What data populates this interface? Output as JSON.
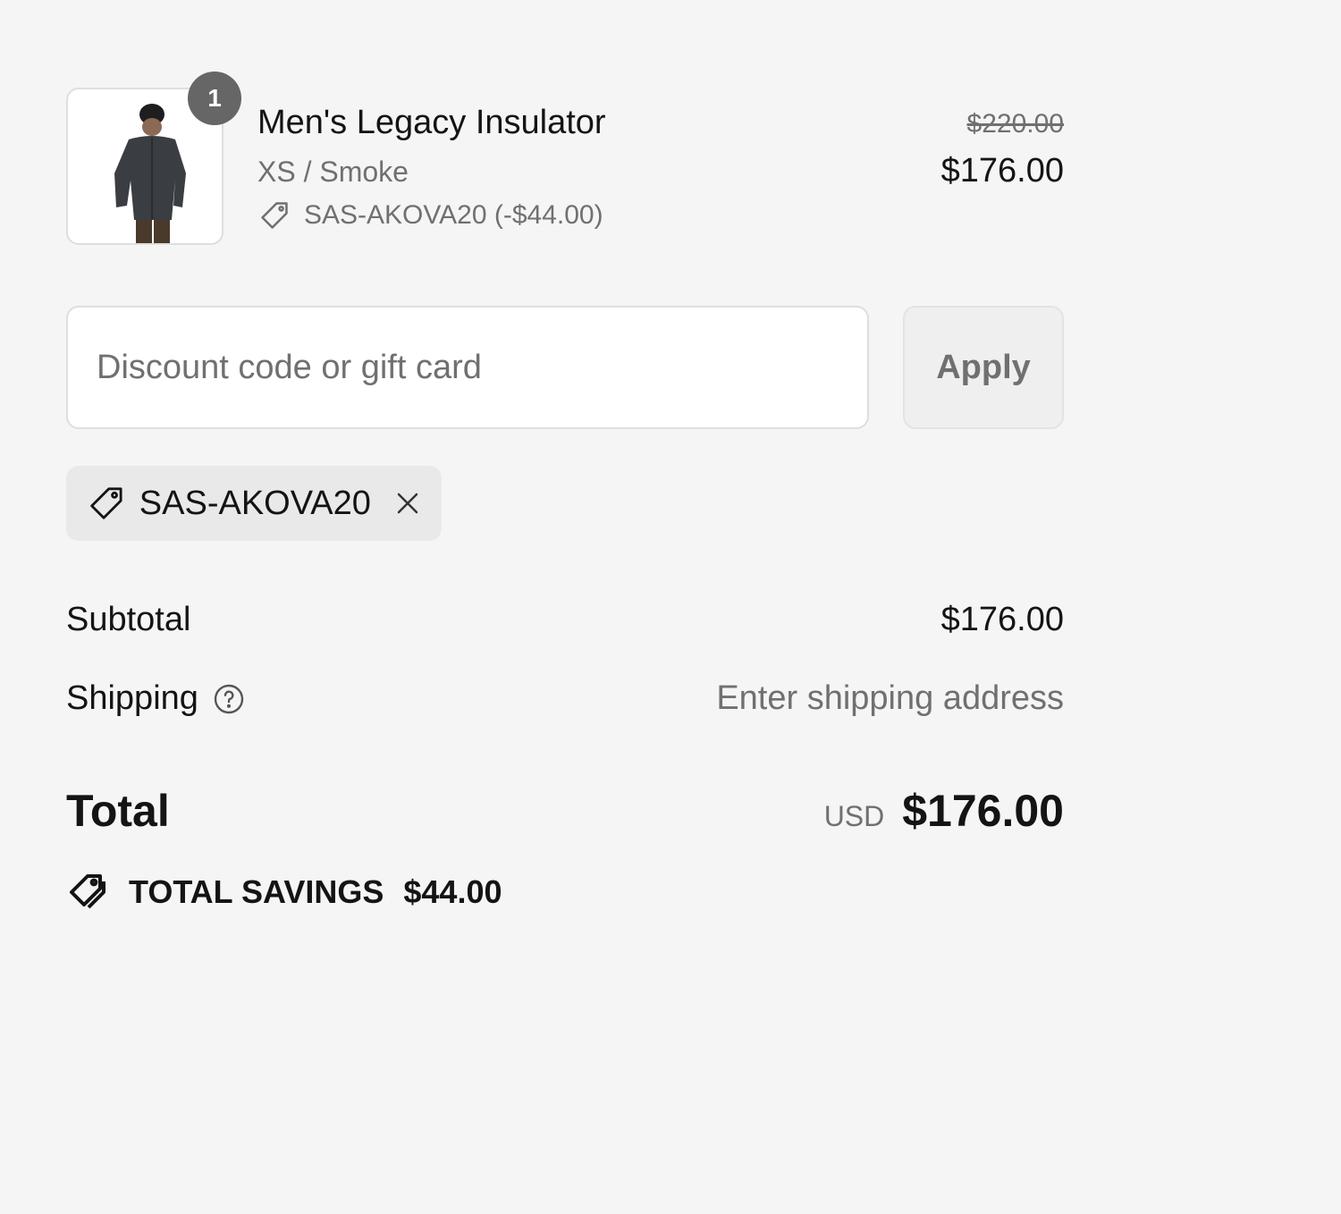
{
  "line_item": {
    "quantity": "1",
    "title": "Men's Legacy Insulator",
    "variant": "XS / Smoke",
    "discount_line": "SAS-AKOVA20 (-$44.00)",
    "original_price": "$220.00",
    "price": "$176.00",
    "image_icon": "jacket-product-image"
  },
  "discount": {
    "placeholder": "Discount code or gift card",
    "value": "",
    "apply_label": "Apply"
  },
  "applied_code": {
    "code": "SAS-AKOVA20",
    "icon": "tag-icon",
    "remove_icon": "close-icon"
  },
  "totals": {
    "subtotal_label": "Subtotal",
    "subtotal_value": "$176.00",
    "shipping_label": "Shipping",
    "shipping_value": "Enter shipping address",
    "total_label": "Total",
    "currency": "USD",
    "total_value": "$176.00",
    "savings_label": "TOTAL SAVINGS",
    "savings_value": "$44.00"
  },
  "colors": {
    "background": "#f5f5f5",
    "text": "#141414",
    "muted": "#707070",
    "badge": "#666666",
    "chip": "#e9e9e9"
  }
}
